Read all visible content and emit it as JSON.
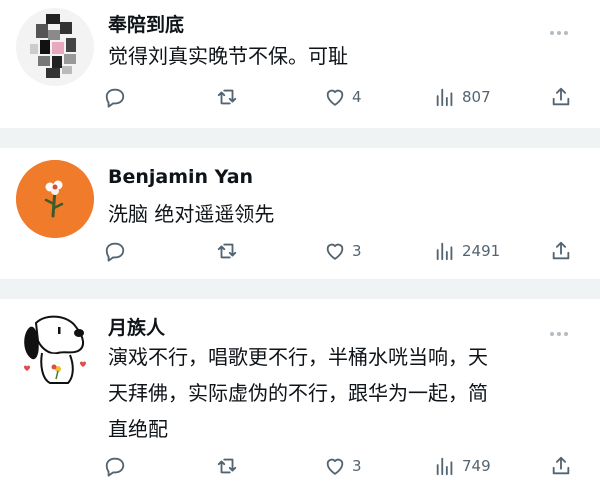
{
  "posts": [
    {
      "author": "奉陪到底",
      "text": "觉得刘真实晚节不保。可耻",
      "likes": "4",
      "views": "807"
    },
    {
      "author": "Benjamin Yan",
      "text": "洗脑 绝对遥遥领先",
      "likes": "3",
      "views": "2491"
    },
    {
      "author": "月族人",
      "text": "演戏不行，唱歌更不行，半桶水咣当响，天\n天拜佛，实际虚伪的不行，跟华为一起，简\n直绝配",
      "likes": "3",
      "views": "749"
    }
  ],
  "icons": {
    "reply": "speech-bubble-icon",
    "repost": "repost-arrows-icon",
    "like": "heart-icon",
    "views": "bar-chart-icon",
    "share": "share-arrow-icon",
    "more": "more-dots-icon"
  },
  "colors": {
    "text": "#0f1419",
    "muted": "#536471",
    "divider": "#eff3f4",
    "avatar2_bg": "#f07c2b"
  }
}
